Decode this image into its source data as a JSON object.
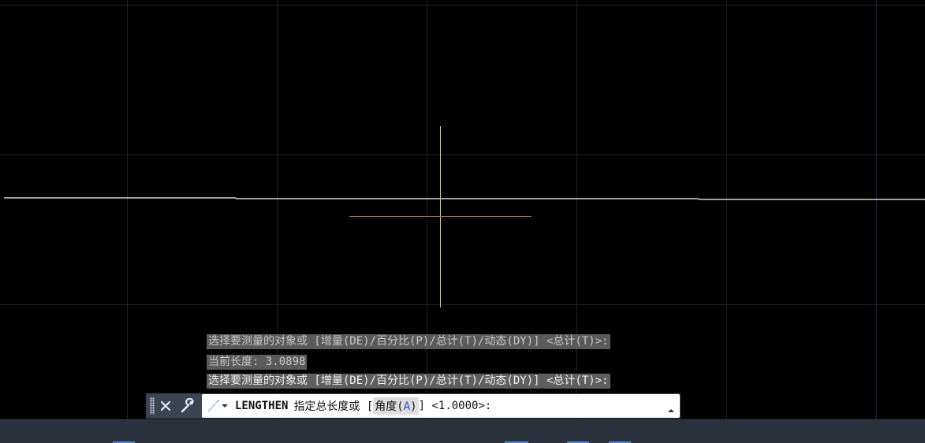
{
  "colors": {
    "background": "#000000",
    "grid": "#1c2026",
    "crosshair_vertical": "#bcd48c",
    "crosshair_horizontal": "#c97e40",
    "drawn_line": "#ffffff",
    "history_bg": "#5a5a5a",
    "command_bar_bg": "#3b4453",
    "option_key": "#1e4fd6",
    "status_bar_bg": "#2b313a"
  },
  "history": [
    {
      "text": "选择要测量的对象或 [增量(DE)/百分比(P)/总计(T)/动态(DY)] <总计(T)>:"
    },
    {
      "text": "当前长度: 3.0898"
    },
    {
      "text": "选择要测量的对象或 [增量(DE)/百分比(P)/总计(T)/动态(DY)] <总计(T)>:"
    }
  ],
  "command_line": {
    "command_name": "LENGTHEN",
    "prompt_text": "指定总长度或 [",
    "option_label": "角度(",
    "option_key": "A",
    "option_close": ")",
    "suffix": "] <1.0000>:",
    "icons": {
      "grip": "grip-handle-icon",
      "close": "close-icon",
      "customize": "wrench-icon",
      "recent": "recent-commands-icon",
      "expand": "expand-up-icon"
    }
  }
}
